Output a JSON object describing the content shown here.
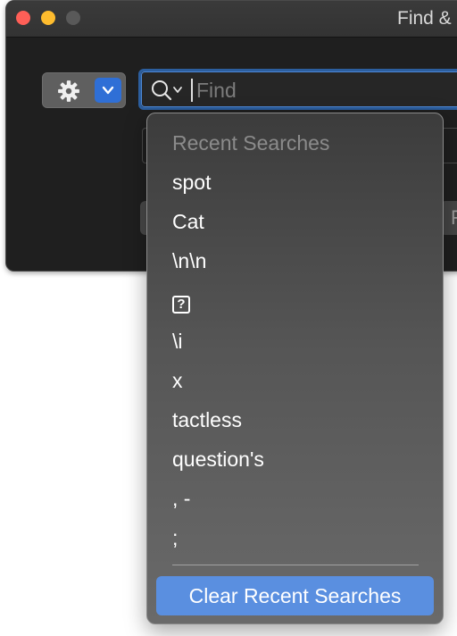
{
  "window": {
    "title": "Find &"
  },
  "search": {
    "placeholder": "Find",
    "value": ""
  },
  "ghost": {
    "right_letter": "F"
  },
  "recent_menu": {
    "header": "Recent Searches",
    "items": [
      "spot",
      "Cat",
      "\\n\\n",
      "?",
      "\\i",
      "x",
      "tactless",
      "question's",
      ", -",
      ";"
    ],
    "clear_label": "Clear Recent Searches"
  },
  "colors": {
    "accent": "#2f6fd6",
    "highlight": "#5a8fe0",
    "window_bg": "#1f1f1f"
  }
}
